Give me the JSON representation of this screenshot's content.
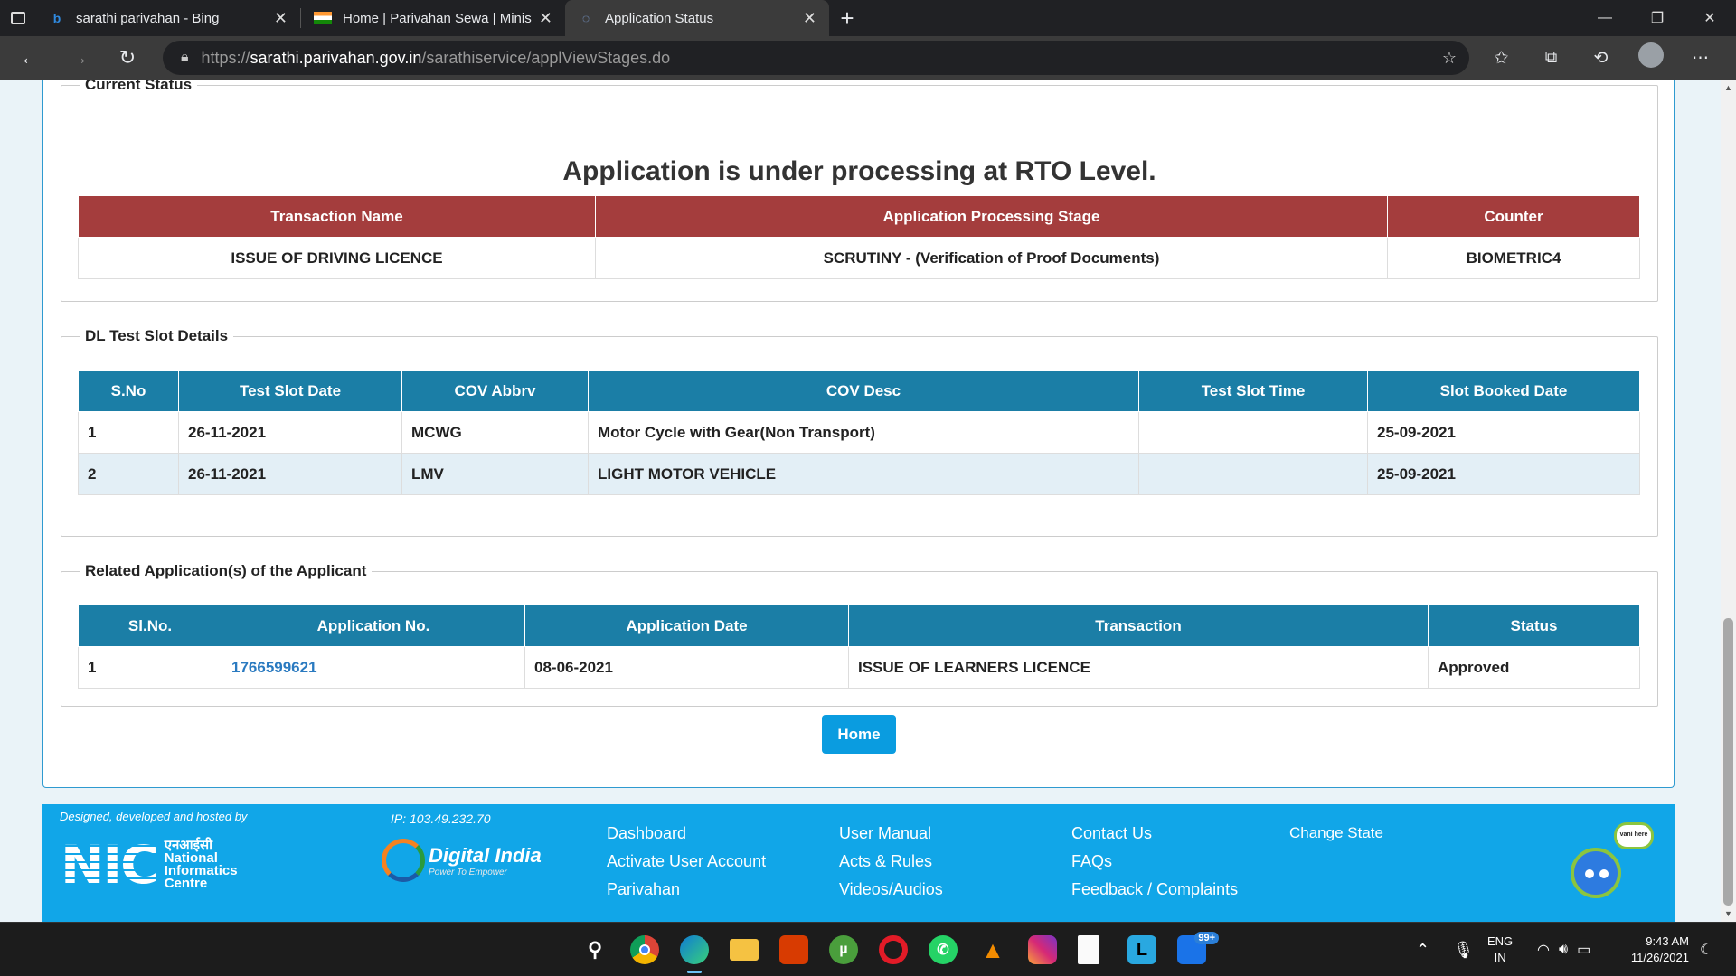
{
  "browser": {
    "tabs": [
      {
        "title": "sarathi parivahan - Bing",
        "icon": "bing-icon"
      },
      {
        "title": "Home | Parivahan Sewa | Ministr",
        "icon": "india-flag-icon"
      },
      {
        "title": "Application Status",
        "icon": "sarathi-icon"
      }
    ],
    "url": {
      "protocol": "https://",
      "host": "sarathi.parivahan.gov.in",
      "path": "/sarathiservice/applViewStages.do"
    }
  },
  "current_status": {
    "legend": "Current Status",
    "message": "Application is under processing at RTO Level.",
    "headers": [
      "Transaction Name",
      "Application Processing Stage",
      "Counter"
    ],
    "row": [
      "ISSUE OF DRIVING LICENCE",
      "SCRUTINY - (Verification of Proof Documents)",
      "BIOMETRIC4"
    ]
  },
  "dl_test_slot": {
    "legend": "DL Test Slot Details",
    "headers": [
      "S.No",
      "Test Slot Date",
      "COV Abbrv",
      "COV Desc",
      "Test Slot Time",
      "Slot Booked Date"
    ],
    "rows": [
      [
        "1",
        "26-11-2021",
        "MCWG",
        "Motor Cycle with Gear(Non Transport)",
        "",
        "25-09-2021"
      ],
      [
        "2",
        "26-11-2021",
        "LMV",
        "LIGHT MOTOR VEHICLE",
        "",
        "25-09-2021"
      ]
    ]
  },
  "related_apps": {
    "legend": "Related Application(s) of the Applicant",
    "headers": [
      "Sl.No.",
      "Application No.",
      "Application Date",
      "Transaction",
      "Status"
    ],
    "rows": [
      [
        "1",
        "1766599621",
        "08-06-2021",
        "ISSUE OF LEARNERS LICENCE",
        "Approved"
      ]
    ]
  },
  "home_button": "Home",
  "footer": {
    "designed_by": "Designed, developed and hosted by",
    "nic_short": "NIC",
    "nic_hindi": "एनआईसी",
    "nic_lines": [
      "National",
      "Informatics",
      "Centre"
    ],
    "ip": "IP: 103.49.232.70",
    "digital_india": "Digital India",
    "digital_india_tag": "Power To Empower",
    "links_col1": [
      "Dashboard",
      "Activate User Account",
      "Parivahan"
    ],
    "links_col2": [
      "User Manual",
      "Acts & Rules",
      "Videos/Audios"
    ],
    "links_col3": [
      "Contact Us",
      "FAQs",
      "Feedback / Complaints"
    ],
    "links_col4": [
      "Change State"
    ],
    "mascot_label": "vani here"
  },
  "taskbar": {
    "badge": "99+",
    "lang_line1": "ENG",
    "lang_line2": "IN",
    "time": "9:43 AM",
    "date": "11/26/2021"
  },
  "colors": {
    "header_red": "#a43d3d",
    "header_blue": "#1b7ea6",
    "footer_blue": "#11a6e8",
    "link": "#2a7ac0"
  }
}
